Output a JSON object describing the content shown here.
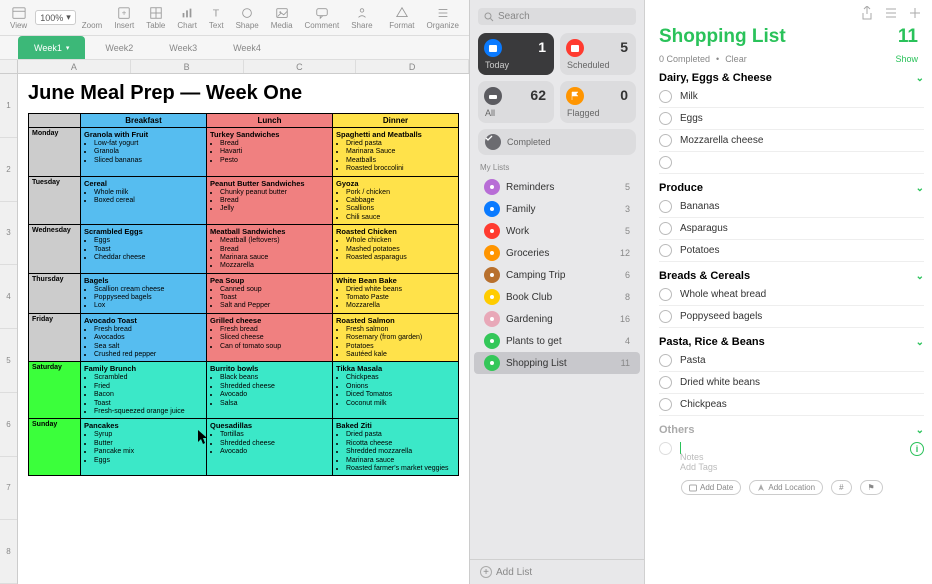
{
  "numbers": {
    "toolbar": {
      "zoom_value": "100%",
      "buttons": [
        "View",
        "Zoom",
        "Insert",
        "Table",
        "Chart",
        "Text",
        "Shape",
        "Media",
        "Comment",
        "Share",
        "Format",
        "Organize"
      ]
    },
    "tabs": [
      "Week1",
      "Week2",
      "Week3",
      "Week4"
    ],
    "active_tab": 0,
    "columns": [
      "A",
      "B",
      "C",
      "D"
    ],
    "rows": [
      "1",
      "2",
      "3",
      "4",
      "5",
      "6",
      "7",
      "8"
    ],
    "sheet_title": "June Meal Prep — Week One",
    "headers": {
      "day": "",
      "breakfast": "Breakfast",
      "lunch": "Lunch",
      "dinner": "Dinner"
    },
    "meals": [
      {
        "day": "Monday",
        "breakfast": {
          "title": "Granola with Fruit",
          "items": [
            "Low-fat yogurt",
            "Granola",
            "Sliced bananas"
          ]
        },
        "lunch": {
          "title": "Turkey Sandwiches",
          "items": [
            "Bread",
            "Havarti",
            "Pesto"
          ]
        },
        "dinner": {
          "title": "Spaghetti and Meatballs",
          "items": [
            "Dried pasta",
            "Marinara Sauce",
            "Meatballs",
            "Roasted broccolini"
          ]
        }
      },
      {
        "day": "Tuesday",
        "breakfast": {
          "title": "Cereal",
          "items": [
            "Whole milk",
            "Boxed cereal"
          ]
        },
        "lunch": {
          "title": "Peanut Butter Sandwiches",
          "items": [
            "Chunky peanut butter",
            "Bread",
            "Jelly"
          ]
        },
        "dinner": {
          "title": "Gyoza",
          "items": [
            "Pork / chicken",
            "Cabbage",
            "Scallions",
            "Chili sauce"
          ]
        }
      },
      {
        "day": "Wednesday",
        "breakfast": {
          "title": "Scrambled Eggs",
          "items": [
            "Eggs",
            "Toast",
            "Cheddar cheese"
          ]
        },
        "lunch": {
          "title": "Meatball Sandwiches",
          "items": [
            "Meatball (leftovers)",
            "Bread",
            "Marinara sauce",
            "Mozzarella"
          ]
        },
        "dinner": {
          "title": "Roasted Chicken",
          "items": [
            "Whole chicken",
            "Mashed potatoes",
            "Roasted asparagus"
          ]
        }
      },
      {
        "day": "Thursday",
        "breakfast": {
          "title": "Bagels",
          "items": [
            "Scallion cream cheese",
            "Poppyseed bagels",
            "Lox"
          ]
        },
        "lunch": {
          "title": "Pea Soup",
          "items": [
            "Canned soup",
            "Toast",
            "Salt and Pepper"
          ]
        },
        "dinner": {
          "title": "White Bean Bake",
          "items": [
            "Dried white beans",
            "Tomato Paste",
            "Mozzarella"
          ]
        }
      },
      {
        "day": "Friday",
        "breakfast": {
          "title": "Avocado Toast",
          "items": [
            "Fresh bread",
            "Avocados",
            "Sea salt",
            "Crushed red pepper"
          ]
        },
        "lunch": {
          "title": "Grilled cheese",
          "items": [
            "Fresh bread",
            "Sliced cheese",
            "Can of tomato soup"
          ]
        },
        "dinner": {
          "title": "Roasted Salmon",
          "items": [
            "Fresh salmon",
            "Rosemary (from garden)",
            "Potatoes",
            "Sautéed kale"
          ]
        }
      },
      {
        "day": "Saturday",
        "breakfast": {
          "title": "Family Brunch",
          "items": [
            "Scrambled",
            "Fried",
            "Bacon",
            "Toast",
            "Fresh-squeezed orange juice"
          ]
        },
        "lunch": {
          "title": "Burrito bowls",
          "items": [
            "Black beans",
            "Shredded cheese",
            "Avocado",
            "Salsa"
          ]
        },
        "dinner": {
          "title": "Tikka Masala",
          "items": [
            "Chickpeas",
            "Onions",
            "Diced Tomatos",
            "Coconut milk"
          ]
        }
      },
      {
        "day": "Sunday",
        "breakfast": {
          "title": "Pancakes",
          "items": [
            "Syrup",
            "Butter",
            "Pancake mix",
            "Eggs"
          ]
        },
        "lunch": {
          "title": "Quesadillas",
          "items": [
            "Tortillas",
            "Shredded cheese",
            "Avocado"
          ]
        },
        "dinner": {
          "title": "Baked Ziti",
          "items": [
            "Dried pasta",
            "Ricotta cheese",
            "Shredded mozzarella",
            "Marinara sauce",
            "Roasted farmer's market veggies"
          ]
        }
      }
    ]
  },
  "reminders": {
    "search_placeholder": "Search",
    "tiles": {
      "today": {
        "label": "Today",
        "count": 1,
        "color": "#0a7aff"
      },
      "scheduled": {
        "label": "Scheduled",
        "count": 5,
        "color": "#ff3b30"
      },
      "all": {
        "label": "All",
        "count": 62,
        "color": "#5b5b60"
      },
      "flagged": {
        "label": "Flagged",
        "count": 0,
        "color": "#ff9500"
      }
    },
    "completed_label": "Completed",
    "section_label": "My Lists",
    "lists": [
      {
        "name": "Reminders",
        "count": 5,
        "color": "#b86dd6"
      },
      {
        "name": "Family",
        "count": 3,
        "color": "#0a7aff"
      },
      {
        "name": "Work",
        "count": 5,
        "color": "#ff3b30"
      },
      {
        "name": "Groceries",
        "count": 12,
        "color": "#ff9500"
      },
      {
        "name": "Camping Trip",
        "count": 6,
        "color": "#b8702e"
      },
      {
        "name": "Book Club",
        "count": 8,
        "color": "#ffcc00"
      },
      {
        "name": "Gardening",
        "count": 16,
        "color": "#e8a8b8"
      },
      {
        "name": "Plants to get",
        "count": 4,
        "color": "#34c759"
      },
      {
        "name": "Shopping List",
        "count": 11,
        "color": "#34c759",
        "selected": true
      }
    ],
    "add_list_label": "Add List",
    "main": {
      "title": "Shopping List",
      "accent": "#2ac25a",
      "count": 11,
      "completed_text": "0 Completed",
      "clear_label": "Clear",
      "show_label": "Show",
      "sections": [
        {
          "name": "Dairy, Eggs & Cheese",
          "items": [
            "Milk",
            "Eggs",
            "Mozzarella cheese"
          ],
          "trailing_blank": true
        },
        {
          "name": "Produce",
          "items": [
            "Bananas",
            "Asparagus",
            "Potatoes"
          ]
        },
        {
          "name": "Breads & Cereals",
          "items": [
            "Whole wheat bread",
            "Poppyseed bagels"
          ]
        },
        {
          "name": "Pasta, Rice & Beans",
          "items": [
            "Pasta",
            "Dried white beans",
            "Chickpeas"
          ]
        },
        {
          "name": "Others",
          "muted": true,
          "new_entry": true
        }
      ],
      "new_item": {
        "notes_placeholder": "Notes",
        "tags_placeholder": "Add Tags",
        "add_date": "Add Date",
        "add_location": "Add Location",
        "hash": "#",
        "flag": "⚑"
      }
    }
  }
}
